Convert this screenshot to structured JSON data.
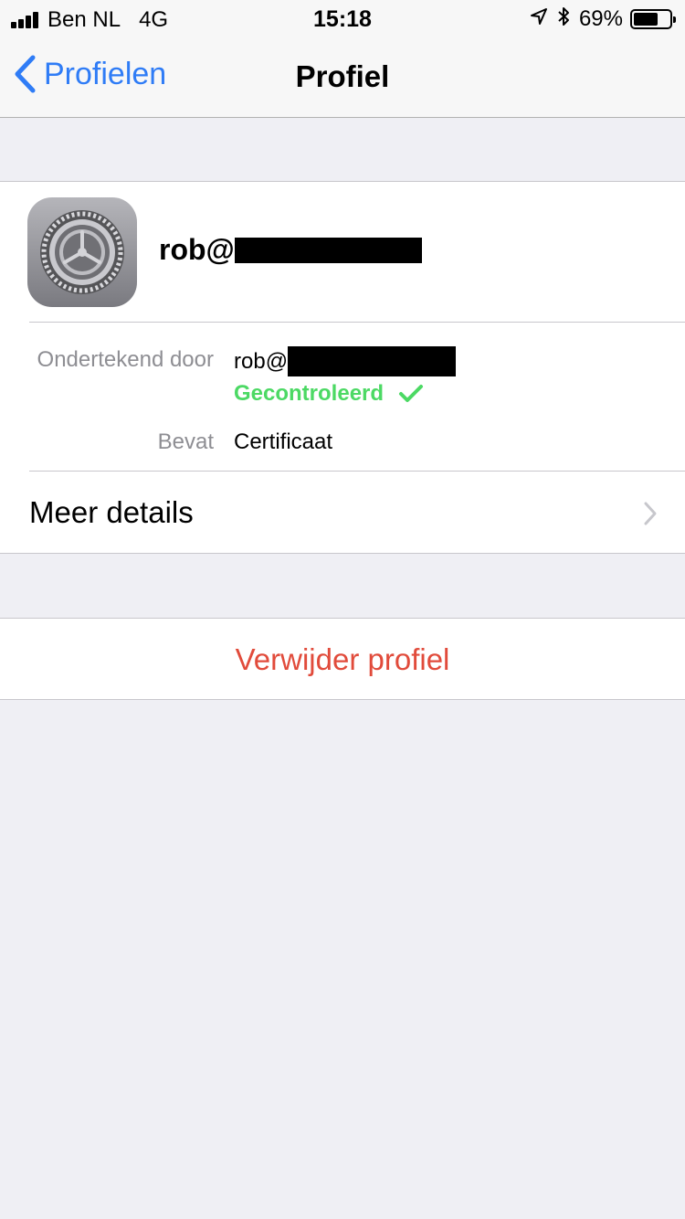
{
  "status_bar": {
    "carrier": "Ben NL",
    "network": "4G",
    "time": "15:18",
    "battery": "69%",
    "battery_level": 0.69,
    "icons": [
      "location-arrow-icon",
      "bluetooth-icon"
    ]
  },
  "nav": {
    "back_label": "Profielen",
    "title": "Profiel"
  },
  "profile": {
    "name": "rob@",
    "signed_by_label": "Ondertekend door",
    "signed_by_value": "rob@",
    "verified": "Gecontroleerd",
    "contains_label": "Bevat",
    "contains_value": "Certificaat",
    "more_details": "Meer details",
    "icon": "settings-gear-icon"
  },
  "actions": {
    "delete_label": "Verwijder profiel"
  },
  "colors": {
    "accent": "#2f7cf6",
    "verified": "#4cd964",
    "destructive": "#e14b3b",
    "background": "#efeff4"
  }
}
